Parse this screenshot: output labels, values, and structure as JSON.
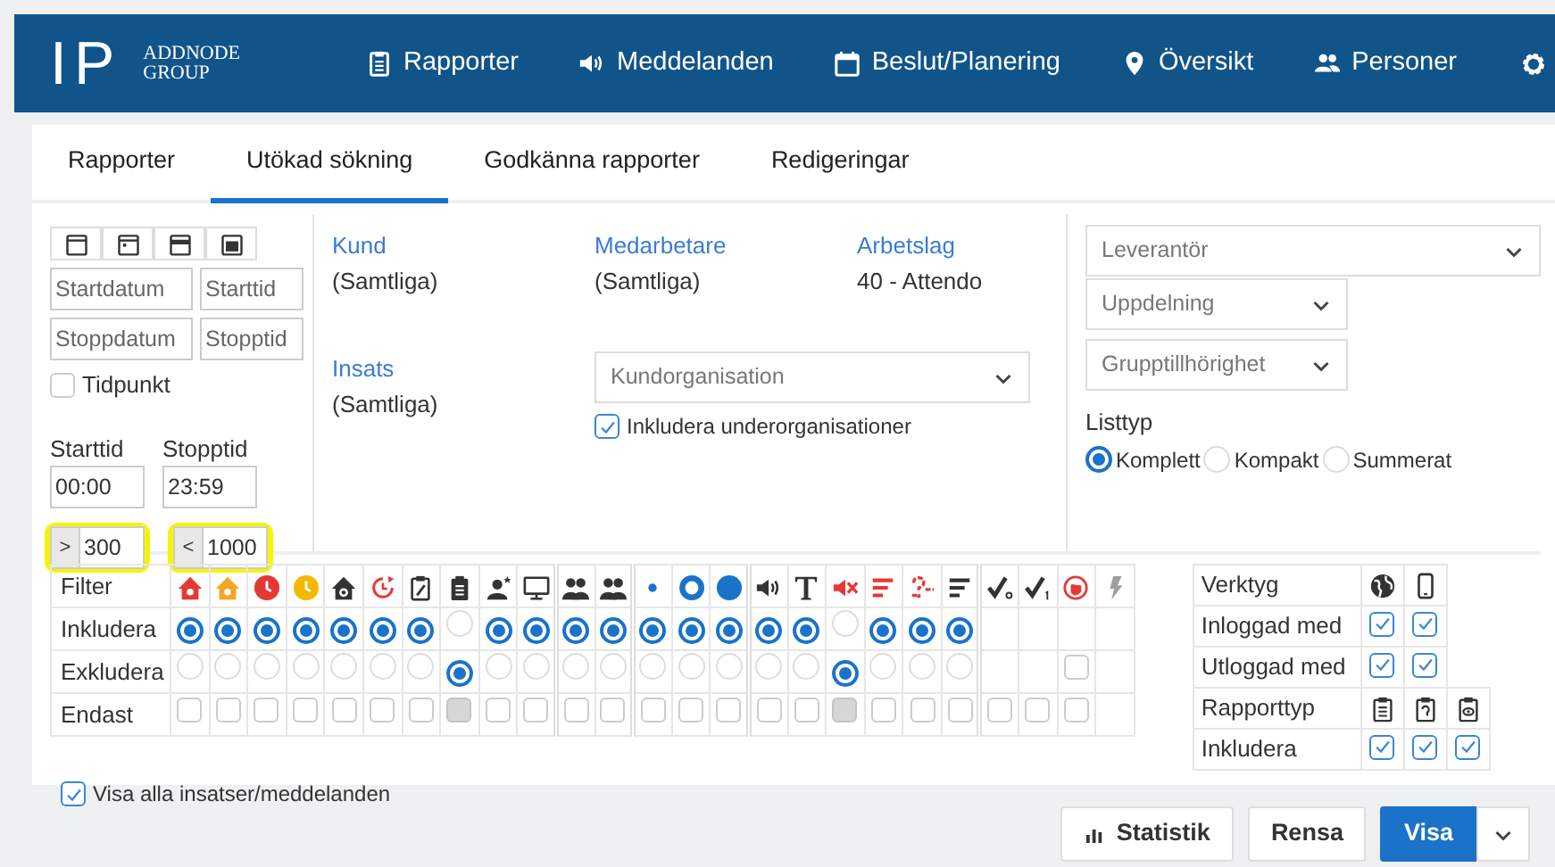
{
  "nav": {
    "logo": {
      "mark": "IP",
      "name_lines": [
        "ADDNODE",
        "GROUP"
      ]
    },
    "items": [
      {
        "kind": "link",
        "label": "Rapporter"
      },
      {
        "kind": "link",
        "label": "Meddelanden"
      },
      {
        "kind": "link",
        "label": "Beslut/Planering"
      },
      {
        "kind": "link",
        "label": "Översikt"
      },
      {
        "kind": "link",
        "label": "Personer"
      },
      {
        "kind": "settings"
      }
    ]
  },
  "tabs": [
    {
      "label": "Rapporter",
      "selected": false
    },
    {
      "label": "Utökad sökning",
      "selected": true
    },
    {
      "label": "Godkänna rapporter",
      "selected": false
    },
    {
      "label": "Redigeringar",
      "selected": false
    }
  ],
  "dates": {
    "start_date": {
      "placeholder": "Startdatum"
    },
    "start_time": {
      "placeholder": "Starttid"
    },
    "stop_date": {
      "placeholder": "Stoppdatum"
    },
    "stop_time": {
      "placeholder": "Stopptid"
    },
    "point_in_time": {
      "label": "Tidpunkt",
      "checked": false
    },
    "time_from": {
      "label": "Starttid",
      "value": "00:00"
    },
    "time_to": {
      "label": "Stopptid",
      "value": "23:59"
    },
    "min": {
      "prefix": ">",
      "value": "300"
    },
    "max": {
      "prefix": "<",
      "value": "1000"
    }
  },
  "criteria": [
    {
      "label": "Kund",
      "value": "(Samtliga)"
    },
    {
      "label": "Medarbetare",
      "value": "(Samtliga)"
    },
    {
      "label": "Arbetslag",
      "value": "40 - Attendo"
    },
    {
      "label": "Insats",
      "value": "(Samtliga)"
    }
  ],
  "organisation": {
    "placeholder": "Kundorganisation",
    "include_sub": {
      "label": "Inkludera underorganisationer",
      "checked": true
    }
  },
  "selects": [
    {
      "placeholder": "Leverantör"
    },
    {
      "placeholder": "Uppdelning"
    },
    {
      "placeholder": "Grupptillhörighet"
    }
  ],
  "list_type": {
    "label": "Listtyp",
    "options": [
      {
        "label": "Komplett",
        "selected": true
      },
      {
        "label": "Kompakt",
        "selected": false
      },
      {
        "label": "Summerat",
        "selected": false
      }
    ]
  },
  "filter": {
    "header": "Filter",
    "row_labels": [
      "Inkludera",
      "Exkludera",
      "Endast"
    ],
    "groups": [
      {
        "columns": [
          {
            "kind": "radio",
            "included": true,
            "excluded": false,
            "only_checked": false,
            "only_disabled": false
          },
          {
            "kind": "radio",
            "included": true,
            "excluded": false,
            "only_checked": false,
            "only_disabled": false
          },
          {
            "kind": "radio",
            "included": true,
            "excluded": false,
            "only_checked": false,
            "only_disabled": false
          },
          {
            "kind": "radio",
            "included": true,
            "excluded": false,
            "only_checked": false,
            "only_disabled": false
          },
          {
            "kind": "radio",
            "included": true,
            "excluded": false,
            "only_checked": false,
            "only_disabled": false
          },
          {
            "kind": "radio",
            "included": true,
            "excluded": false,
            "only_checked": false,
            "only_disabled": false
          },
          {
            "kind": "radio",
            "included": true,
            "excluded": false,
            "only_checked": false,
            "only_disabled": false
          },
          {
            "kind": "radio",
            "included": false,
            "excluded": true,
            "only_checked": false,
            "only_disabled": true
          },
          {
            "kind": "radio",
            "included": true,
            "excluded": false,
            "only_checked": false,
            "only_disabled": false
          },
          {
            "kind": "radio",
            "included": true,
            "excluded": false,
            "only_checked": false,
            "only_disabled": false
          }
        ]
      },
      {
        "columns": [
          {
            "kind": "radio",
            "included": true,
            "excluded": false,
            "only_checked": false,
            "only_disabled": false
          },
          {
            "kind": "radio",
            "included": true,
            "excluded": false,
            "only_checked": false,
            "only_disabled": false
          }
        ]
      },
      {
        "columns": [
          {
            "kind": "radio",
            "included": true,
            "excluded": false,
            "only_checked": false,
            "only_disabled": false
          },
          {
            "kind": "radio",
            "included": true,
            "excluded": false,
            "only_checked": false,
            "only_disabled": false
          },
          {
            "kind": "radio",
            "included": true,
            "excluded": false,
            "only_checked": false,
            "only_disabled": false
          }
        ]
      },
      {
        "columns": [
          {
            "kind": "radio",
            "included": true,
            "excluded": false,
            "only_checked": false,
            "only_disabled": false
          },
          {
            "kind": "radio",
            "included": true,
            "excluded": false,
            "only_checked": false,
            "only_disabled": false
          },
          {
            "kind": "radio",
            "included": false,
            "excluded": true,
            "only_checked": false,
            "only_disabled": true
          },
          {
            "kind": "radio",
            "included": true,
            "excluded": false,
            "only_checked": false,
            "only_disabled": false
          },
          {
            "kind": "radio",
            "included": true,
            "excluded": false,
            "only_checked": false,
            "only_disabled": false
          },
          {
            "kind": "radio",
            "included": true,
            "excluded": false,
            "only_checked": false,
            "only_disabled": false
          }
        ]
      },
      {
        "columns": [
          {
            "kind": "check",
            "only_checked": false
          },
          {
            "kind": "check",
            "only_checked": false
          },
          {
            "kind": "check",
            "exclude_checked": false,
            "only_checked": false
          },
          {
            "kind": "check"
          }
        ]
      }
    ]
  },
  "tools": {
    "header": "Verktyg",
    "rows": [
      {
        "label": "Inloggad med",
        "checks": [
          true,
          true
        ]
      },
      {
        "label": "Utloggad med",
        "checks": [
          true,
          true
        ]
      }
    ]
  },
  "report_types": {
    "header": "Rapporttyp",
    "rows": [
      {
        "label": "Inkludera",
        "checks": [
          true,
          true,
          true
        ]
      }
    ]
  },
  "show_all": {
    "label": "Visa alla insatser/meddelanden",
    "checked": true
  },
  "actions": [
    {
      "kind": "stats",
      "label": "Statistik"
    },
    {
      "kind": "plain",
      "label": "Rensa"
    },
    {
      "kind": "primary",
      "label": "Visa"
    },
    {
      "kind": "caret"
    }
  ]
}
